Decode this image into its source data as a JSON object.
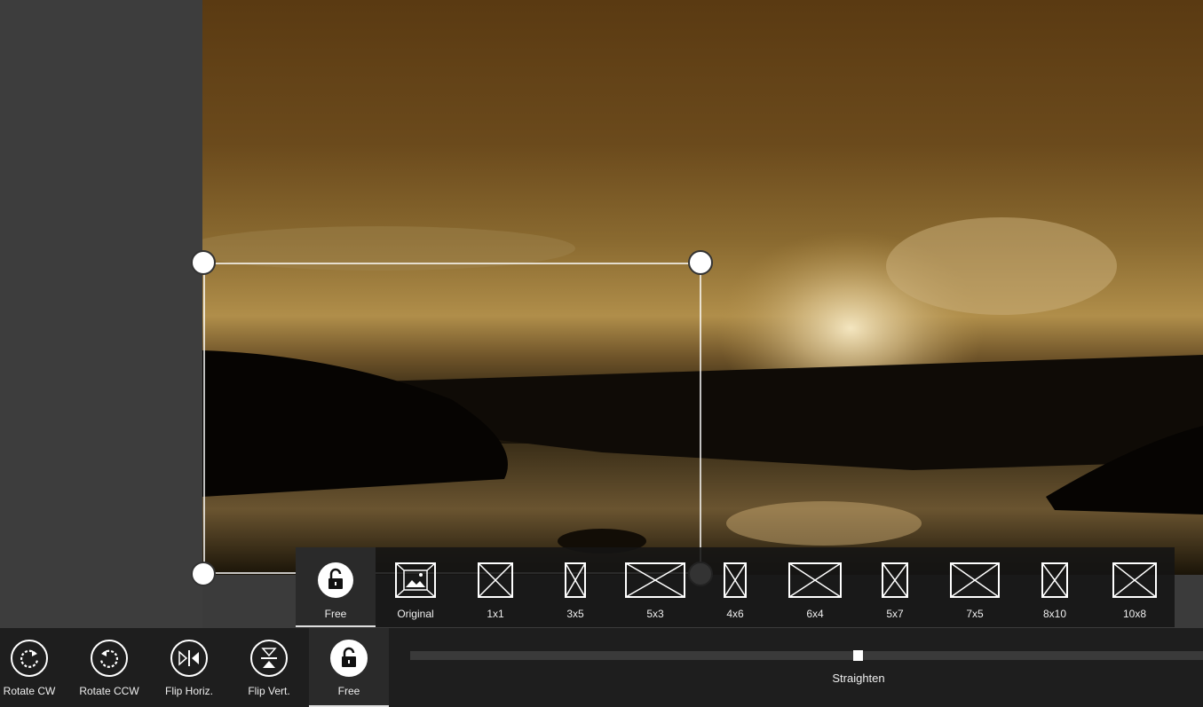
{
  "aspect_ratios": [
    {
      "label": "Free",
      "icon": "unlock-icon",
      "selected": true
    },
    {
      "label": "Original",
      "icon": "image-icon"
    },
    {
      "label": "1x1",
      "icon": "ratio-1x1-icon"
    },
    {
      "label": "3x5",
      "icon": "ratio-3x5-icon"
    },
    {
      "label": "5x3",
      "icon": "ratio-5x3-icon"
    },
    {
      "label": "4x6",
      "icon": "ratio-4x6-icon"
    },
    {
      "label": "6x4",
      "icon": "ratio-6x4-icon"
    },
    {
      "label": "5x7",
      "icon": "ratio-5x7-icon"
    },
    {
      "label": "7x5",
      "icon": "ratio-7x5-icon"
    },
    {
      "label": "8x10",
      "icon": "ratio-8x10-icon"
    },
    {
      "label": "10x8",
      "icon": "ratio-10x8-icon"
    }
  ],
  "toolbar": {
    "rotate_cw": "Rotate CW",
    "rotate_ccw": "Rotate CCW",
    "flip_horiz": "Flip Horiz.",
    "flip_vert": "Flip Vert.",
    "free": "Free"
  },
  "straighten": {
    "label": "Straighten",
    "value_fraction": 0.565
  },
  "colors": {
    "toolbar_bg": "#1e1e1e",
    "panel_bg": "#3b3b3b",
    "accent": "#ffffff"
  }
}
